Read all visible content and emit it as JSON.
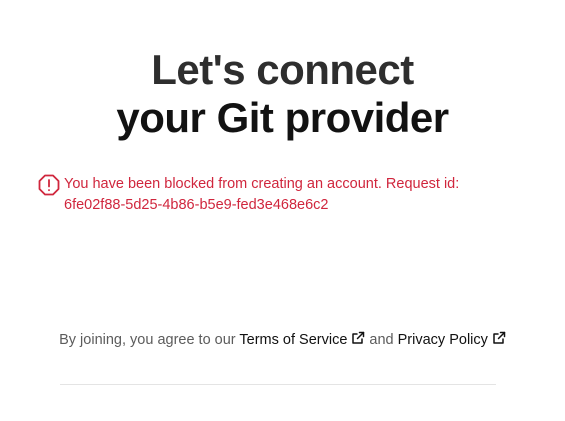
{
  "heading": {
    "line1": "Let's connect",
    "line2": "your Git provider"
  },
  "error": {
    "icon": "alert-octagon-icon",
    "line1": "You have been blocked from creating an account. Request id:",
    "line2": "6fe02f88-5d25-4b86-b5e9-fed3e468e6c2",
    "color": "#d0263d"
  },
  "legal": {
    "prefix": "By joining, you agree to our ",
    "terms_label": "Terms of Service",
    "conjunction": " and ",
    "privacy_label": "Privacy Policy",
    "link_icon": "external-link-icon"
  }
}
